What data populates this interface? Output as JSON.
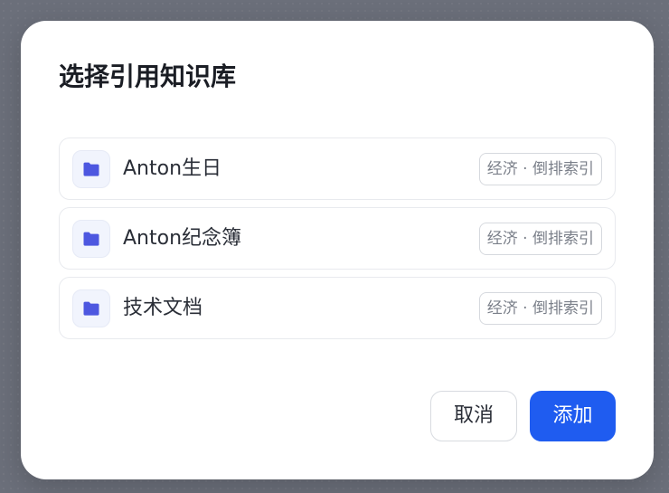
{
  "dialog": {
    "title": "选择引用知识库",
    "items": [
      {
        "label": "Anton生日",
        "tag": "经济 · 倒排索引",
        "icon": "folder-icon"
      },
      {
        "label": "Anton纪念簿",
        "tag": "经济 · 倒排索引",
        "icon": "folder-icon"
      },
      {
        "label": "技术文档",
        "tag": "经济 · 倒排索引",
        "icon": "folder-icon"
      }
    ],
    "buttons": {
      "cancel_label": "取消",
      "add_label": "添加"
    }
  },
  "colors": {
    "accent": "#1f5cf0",
    "folder_icon": "#4d57e0",
    "overlay": "#6b6f7a"
  }
}
